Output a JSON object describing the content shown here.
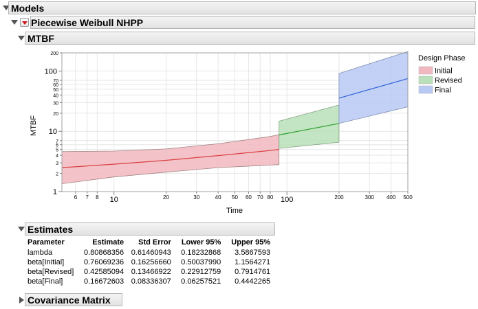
{
  "report": {
    "models_title": "Models",
    "model_title": "Piecewise Weibull NHPP",
    "mtbf_title": "MTBF",
    "estimates_title": "Estimates",
    "covariance_title": "Covariance Matrix"
  },
  "legend": {
    "title": "Design Phase",
    "items": [
      {
        "label": "Initial",
        "color": "#f2b8bf"
      },
      {
        "label": "Revised",
        "color": "#b9e0b9"
      },
      {
        "label": "Final",
        "color": "#b8c9f4"
      }
    ]
  },
  "estimates": {
    "headers": [
      "Parameter",
      "Estimate",
      "Std Error",
      "Lower 95%",
      "Upper 95%"
    ],
    "rows": [
      [
        "lambda",
        "0.80868356",
        "0.61460943",
        "0.18232868",
        "3.5867593"
      ],
      [
        "beta[Initial]",
        "0.76069236",
        "0.16256660",
        "0.50037990",
        "1.1564271"
      ],
      [
        "beta[Revised]",
        "0.42585094",
        "0.13466922",
        "0.22912759",
        "0.7914761"
      ],
      [
        "beta[Final]",
        "0.16672603",
        "0.08336307",
        "0.06257521",
        "0.4442265"
      ]
    ]
  },
  "chart_data": {
    "type": "area",
    "xlabel": "Time",
    "ylabel": "MTBF",
    "xscale": "log",
    "yscale": "log",
    "xlim": [
      5,
      500
    ],
    "ylim": [
      1,
      200
    ],
    "grid": true,
    "legend_position": "right",
    "x_ticks": [
      {
        "v": 6,
        "label": "6",
        "major": false
      },
      {
        "v": 7,
        "label": "7",
        "major": false
      },
      {
        "v": 8,
        "label": "8",
        "major": false
      },
      {
        "v": 10,
        "label": "10",
        "major": true
      },
      {
        "v": 20,
        "label": "20",
        "major": false
      },
      {
        "v": 30,
        "label": "30",
        "major": false
      },
      {
        "v": 40,
        "label": "40",
        "major": false
      },
      {
        "v": 50,
        "label": "50",
        "major": false
      },
      {
        "v": 60,
        "label": "60",
        "major": false
      },
      {
        "v": 70,
        "label": "70",
        "major": false
      },
      {
        "v": 80,
        "label": "80",
        "major": false
      },
      {
        "v": 100,
        "label": "100",
        "major": true
      },
      {
        "v": 200,
        "label": "200",
        "major": false
      },
      {
        "v": 300,
        "label": "300",
        "major": false
      },
      {
        "v": 400,
        "label": "400",
        "major": false
      },
      {
        "v": 500,
        "label": "500",
        "major": false
      }
    ],
    "y_ticks": [
      {
        "v": 1,
        "label": "1",
        "major": true
      },
      {
        "v": 2,
        "label": "2",
        "major": false
      },
      {
        "v": 3,
        "label": "3",
        "major": false
      },
      {
        "v": 4,
        "label": "4",
        "major": false
      },
      {
        "v": 5,
        "label": "5",
        "major": false
      },
      {
        "v": 6,
        "label": "6",
        "major": false
      },
      {
        "v": 7,
        "label": "7",
        "major": false
      },
      {
        "v": 10,
        "label": "10",
        "major": true
      },
      {
        "v": 20,
        "label": "20",
        "major": false
      },
      {
        "v": 30,
        "label": "30",
        "major": false
      },
      {
        "v": 40,
        "label": "40",
        "major": false
      },
      {
        "v": 50,
        "label": "50",
        "major": false
      },
      {
        "v": 60,
        "label": "60",
        "major": false
      },
      {
        "v": 70,
        "label": "70",
        "major": false
      },
      {
        "v": 100,
        "label": "100",
        "major": true
      },
      {
        "v": 200,
        "label": "200",
        "major": false
      }
    ],
    "series": [
      {
        "name": "Initial",
        "fill": "#f2b8bf",
        "edge": "#a08080",
        "line": "#d94040",
        "x": [
          5,
          10,
          20,
          40,
          80,
          90
        ],
        "mean": [
          2.5,
          2.85,
          3.3,
          3.95,
          4.8,
          5.0
        ],
        "lower": [
          1.35,
          1.75,
          2.1,
          2.5,
          2.75,
          2.8
        ],
        "upper": [
          4.6,
          4.7,
          5.1,
          6.2,
          8.2,
          8.8
        ]
      },
      {
        "name": "Revised",
        "fill": "#b9e0b9",
        "edge": "#80a080",
        "line": "#2ea02e",
        "x": [
          90,
          200
        ],
        "mean": [
          8.7,
          13.5
        ],
        "lower": [
          5.2,
          6.6
        ],
        "upper": [
          14.7,
          27.3
        ]
      },
      {
        "name": "Final",
        "fill": "#b8c9f4",
        "edge": "#8090b0",
        "line": "#3060d8",
        "x": [
          200,
          500
        ],
        "mean": [
          35.5,
          75
        ],
        "lower": [
          13.5,
          25.5
        ],
        "upper": [
          91,
          210
        ]
      }
    ]
  }
}
